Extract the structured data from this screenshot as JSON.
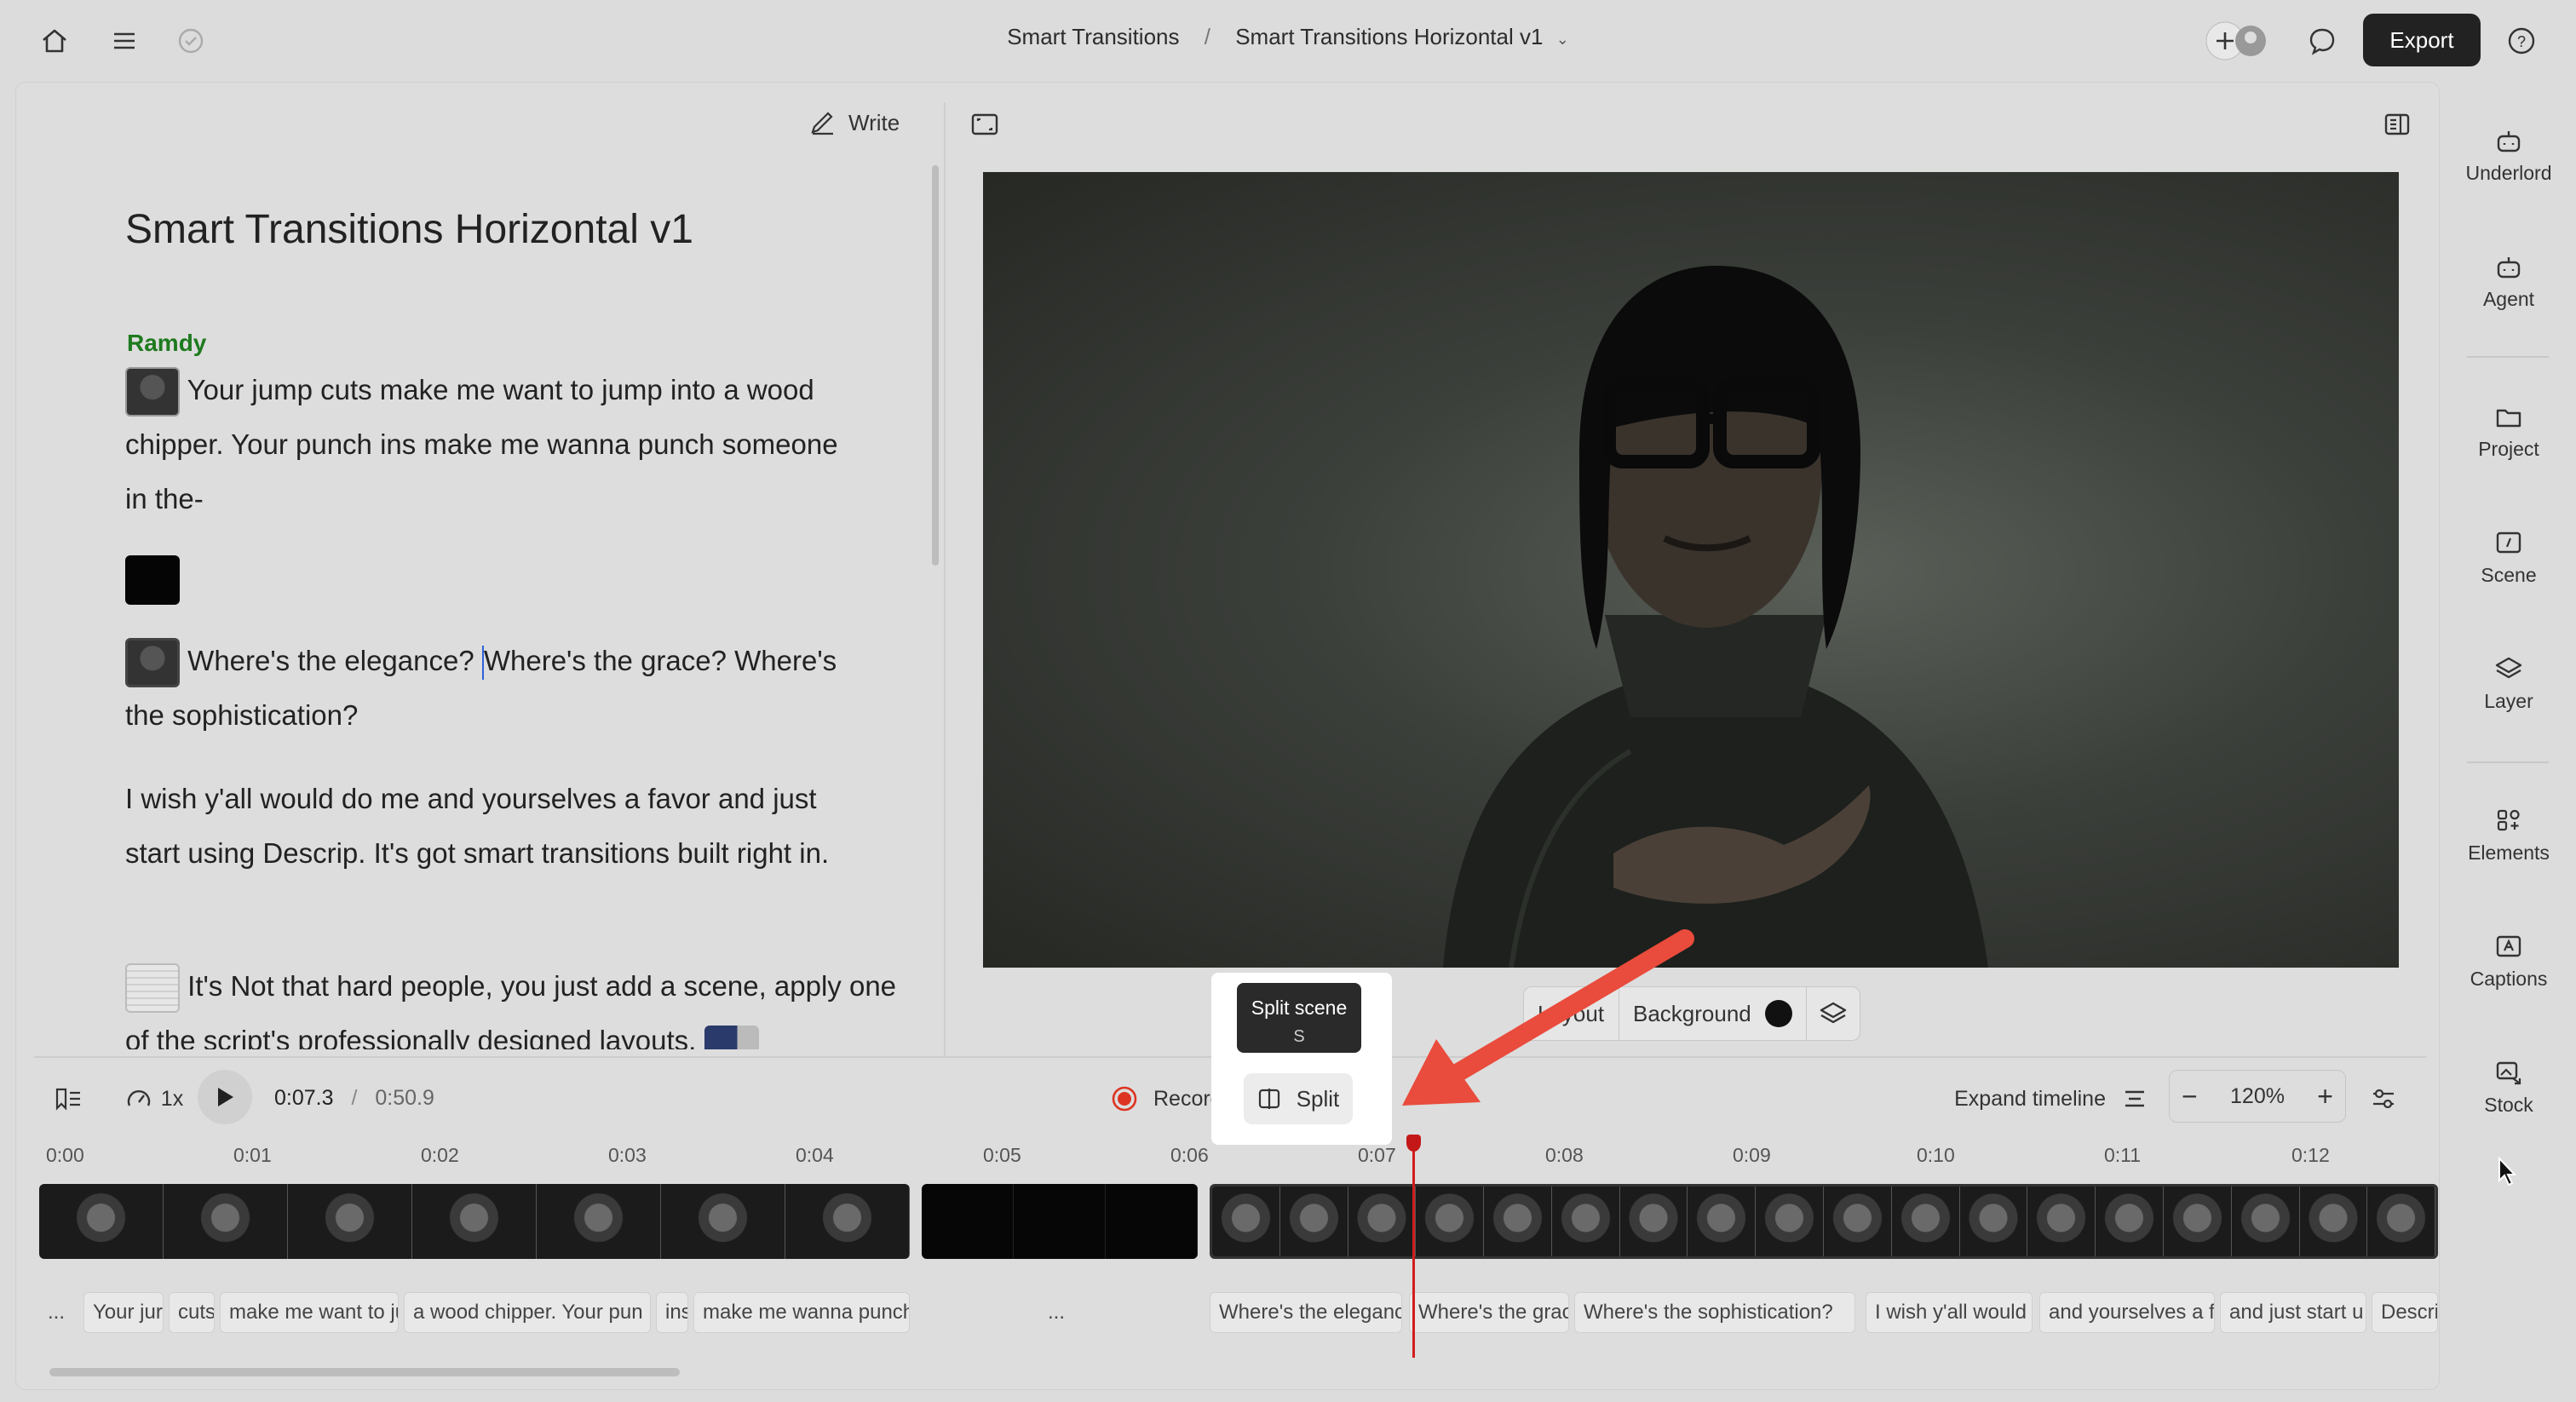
{
  "topbar": {
    "breadcrumb_project": "Smart Transitions",
    "breadcrumb_separator": "/",
    "breadcrumb_composition": "Smart Transitions Horizontal v1",
    "export_label": "Export"
  },
  "script": {
    "write_label": "Write",
    "title": "Smart Transitions Horizontal v1",
    "speaker": "Ramdy",
    "p1": "Your jump cuts make me want to jump into a wood chipper. Your punch ins make me wanna punch someone in the-",
    "p2a": "Where's the elegance? ",
    "p2b": "Where's the grace? Where's the sophistication?",
    "p3": "I wish y'all would do me and yourselves a favor and just start using Descrip. It's got smart transitions built right in.",
    "p4": "It's Not that hard people, you just add a scene, apply one of the script's professionally designed layouts,"
  },
  "canvas_toolbar": {
    "layout_label": "Layout",
    "background_label": "Background",
    "background_color": "#111111"
  },
  "rail": [
    {
      "label": "Underlord",
      "icon": "robot-icon"
    },
    {
      "label": "Agent",
      "icon": "robot-icon"
    },
    {
      "label": "Project",
      "icon": "folder-icon"
    },
    {
      "label": "Scene",
      "icon": "scene-icon"
    },
    {
      "label": "Layer",
      "icon": "layers-icon"
    },
    {
      "label": "Elements",
      "icon": "elements-icon"
    },
    {
      "label": "Captions",
      "icon": "captions-icon"
    },
    {
      "label": "Stock",
      "icon": "stock-icon"
    }
  ],
  "playbar": {
    "speed": "1x",
    "current_time": "0:07.3",
    "time_separator": "/",
    "total_time": "0:50.9",
    "record_label": "Record",
    "split_label": "Split",
    "tooltip_title": "Split scene",
    "tooltip_shortcut": "S",
    "expand_label": "Expand timeline",
    "zoom": "120%"
  },
  "ruler": [
    "0:00",
    "0:01",
    "0:02",
    "0:03",
    "0:04",
    "0:05",
    "0:06",
    "0:07",
    "0:08",
    "0:09",
    "0:10",
    "0:11",
    "0:12"
  ],
  "words": [
    "...",
    "Your jur",
    "cuts",
    "make me want to ju",
    "a wood chipper. Your pun",
    "ins",
    "make me wanna punch",
    "...",
    "Where's the eleganc",
    "Where's the grac",
    "Where's the sophistication?",
    "I wish y'all would",
    "and yourselves a f",
    "and just start u",
    "Descrip"
  ],
  "colors": {
    "accent_red": "#e53e3e",
    "playhead": "#d21d1d",
    "speaker_green": "#1e7a1e"
  }
}
